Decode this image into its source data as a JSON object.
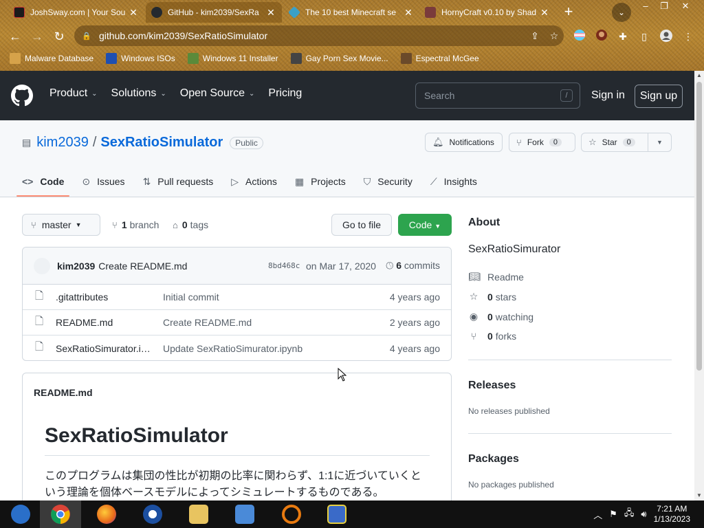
{
  "browser": {
    "tabs": [
      {
        "title": "JoshSway.com | Your Sou",
        "favicon_color": "#1b1b1b",
        "active": false
      },
      {
        "title": "GitHub - kim2039/SexRa",
        "favicon_color": "#24292f",
        "active": true
      },
      {
        "title": "The 10 best Minecraft se",
        "favicon_color": "#3aa0c8",
        "active": false
      },
      {
        "title": "HornyCraft v0.10 by Shad",
        "favicon_color": "#7a3b3b",
        "active": false
      }
    ],
    "url": "github.com/kim2039/SexRatioSimulator",
    "bookmarks": [
      {
        "label": "Malware Database",
        "icon_color": "#d6a24a"
      },
      {
        "label": "Windows ISOs",
        "icon_color": "#1f4fb0"
      },
      {
        "label": "Windows 11 Installer",
        "icon_color": "#5a8a3a"
      },
      {
        "label": "Gay Porn Sex Movie...",
        "icon_color": "#444"
      },
      {
        "label": "Espectral McGee",
        "icon_color": "#6b4a2a"
      }
    ]
  },
  "gh": {
    "nav": [
      {
        "label": "Product",
        "caret": true
      },
      {
        "label": "Solutions",
        "caret": true
      },
      {
        "label": "Open Source",
        "caret": true
      },
      {
        "label": "Pricing",
        "caret": false
      }
    ],
    "search_placeholder": "Search",
    "search_key": "/",
    "signin": "Sign in",
    "signup": "Sign up"
  },
  "repo": {
    "owner": "kim2039",
    "separator": "/",
    "name": "SexRatioSimulator",
    "visibility": "Public",
    "notifications_label": "Notifications",
    "fork_label": "Fork",
    "fork_count": "0",
    "star_label": "Star",
    "star_count": "0",
    "tabs": [
      {
        "label": "Code",
        "icon": "code-icon",
        "glyph": "</>",
        "active": true
      },
      {
        "label": "Issues",
        "icon": "issue-icon",
        "glyph": "⊙",
        "active": false
      },
      {
        "label": "Pull requests",
        "icon": "pull-request-icon",
        "glyph": "⇅",
        "active": false
      },
      {
        "label": "Actions",
        "icon": "play-icon",
        "glyph": "▷",
        "active": false
      },
      {
        "label": "Projects",
        "icon": "table-icon",
        "glyph": "▦",
        "active": false
      },
      {
        "label": "Security",
        "icon": "shield-icon",
        "glyph": "⛉",
        "active": false
      },
      {
        "label": "Insights",
        "icon": "graph-icon",
        "glyph": "⟋",
        "active": false
      }
    ]
  },
  "code": {
    "branch": "master",
    "branch_count": "1",
    "branch_label": "branch",
    "tag_count": "0",
    "tag_label": "tags",
    "go_to_file": "Go to file",
    "code_button": "Code",
    "commit": {
      "author": "kim2039",
      "message": "Create README.md",
      "sha": "8bd468c",
      "date": "on Mar 17, 2020",
      "commit_count": "6",
      "commit_label": "commits"
    },
    "files": [
      {
        "name": ".gitattributes",
        "message": "Initial commit",
        "age": "4 years ago"
      },
      {
        "name": "README.md",
        "message": "Create README.md",
        "age": "2 years ago"
      },
      {
        "name": "SexRatioSimurator.ipynb",
        "message": "Update SexRatioSimurator.ipynb",
        "age": "4 years ago"
      }
    ],
    "readme_title": "README.md",
    "readme_h1": "SexRatioSimulator",
    "readme_text": "このプログラムは集団の性比が初期の比率に関わらず、1:1に近づいていくという理論を個体ベースモデルによってシミュレートするものである。"
  },
  "about": {
    "heading": "About",
    "description": "SexRatioSimurator",
    "readme_label": "Readme",
    "stars_count": "0",
    "stars_label": "stars",
    "watching_count": "0",
    "watching_label": "watching",
    "forks_count": "0",
    "forks_label": "forks",
    "releases_heading": "Releases",
    "releases_text": "No releases published",
    "packages_heading": "Packages",
    "packages_text": "No packages published"
  },
  "taskbar": {
    "apps": [
      {
        "name": "windows-media-center",
        "color": "#2a6fc9"
      },
      {
        "name": "chrome",
        "color": "#e0b030"
      },
      {
        "name": "firefox",
        "color": "#e86a1a"
      },
      {
        "name": "obama-app",
        "color": "#1c4fa0"
      },
      {
        "name": "file-explorer",
        "color": "#e8c460"
      },
      {
        "name": "network-app",
        "color": "#4a8ad8"
      },
      {
        "name": "search-app",
        "color": "#e87a10"
      },
      {
        "name": "paint-app",
        "color": "#3a6ac8"
      }
    ],
    "time": "7:21 AM",
    "date": "1/13/2023"
  }
}
